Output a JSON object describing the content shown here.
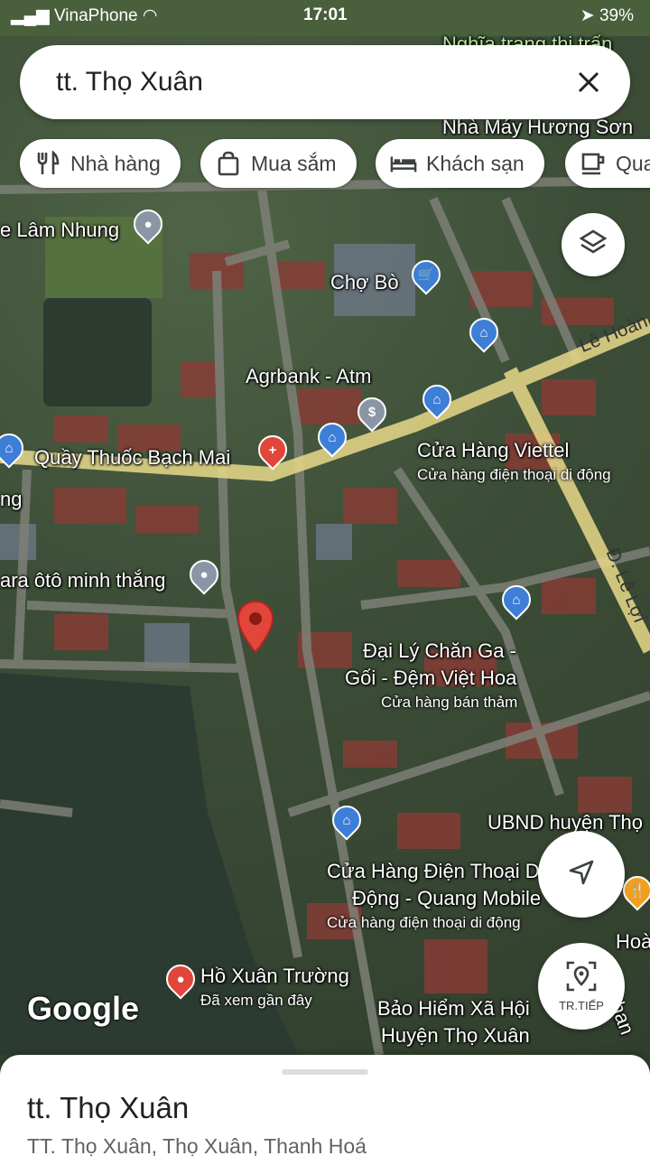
{
  "status_bar": {
    "carrier": "VinaPhone",
    "time": "17:01",
    "battery": "39%"
  },
  "search": {
    "query": "tt. Thọ Xuân"
  },
  "chips": [
    {
      "label": "Nhà hàng",
      "icon": "restaurant-icon"
    },
    {
      "label": "Mua sắm",
      "icon": "shopping-bag-icon"
    },
    {
      "label": "Khách sạn",
      "icon": "hotel-bed-icon"
    },
    {
      "label": "Qua",
      "icon": "cafe-icon"
    }
  ],
  "map": {
    "places": {
      "nghia_trang": "Nghĩa trang thị trấn",
      "nha_may": "Nhà Máy Hương Sơn",
      "lam_nhung": "e Lâm Nhung",
      "cho_bo": "Chợ Bò",
      "agribank": "Agrbank - Atm",
      "quay_thuoc": "Quầy Thuốc Bạch Mai",
      "ng": "ng",
      "viettel": "Cửa Hàng Viettel",
      "viettel_sub": "Cửa hàng điện thoại di động",
      "gara": "ara ôtô minh thắng",
      "chan_ga": "Đại Lý Chăn Ga -",
      "goi_dem": "Gối - Đệm Việt Hoa",
      "chan_ga_sub": "Cửa hàng bán thảm",
      "ubnd": "UBND huyện Thọ",
      "quang_mobile_1": "Cửa Hàng Điện Thoại Di",
      "quang_mobile_2": "Động - Quang Mobile",
      "quang_mobile_sub": "Cửa hàng điện thoại di động",
      "ho_xuan_truong": "Hồ Xuân Trường",
      "ho_xuan_truong_sub": "Đã xem gần đây",
      "bao_hiem_1": "Bảo Hiểm Xã Hội",
      "bao_hiem_2": "Huyện Thọ Xuân",
      "hoa": "Hoà",
      "phan": "Phan"
    },
    "roads": {
      "le_hoan": "Lê Hoàn",
      "le_loi": "Đ. Lê Lợi"
    }
  },
  "buttons": {
    "street_view_label": "TR.TIẾP"
  },
  "branding": "Google",
  "sheet": {
    "title": "tt. Thọ Xuân",
    "subtitle": "TT. Thọ Xuân, Thọ Xuân, Thanh Hoá"
  },
  "colors": {
    "pin_red": "#e2453a",
    "poi_blue": "#3d7ed6",
    "road_yellow": "#e8d98a"
  }
}
